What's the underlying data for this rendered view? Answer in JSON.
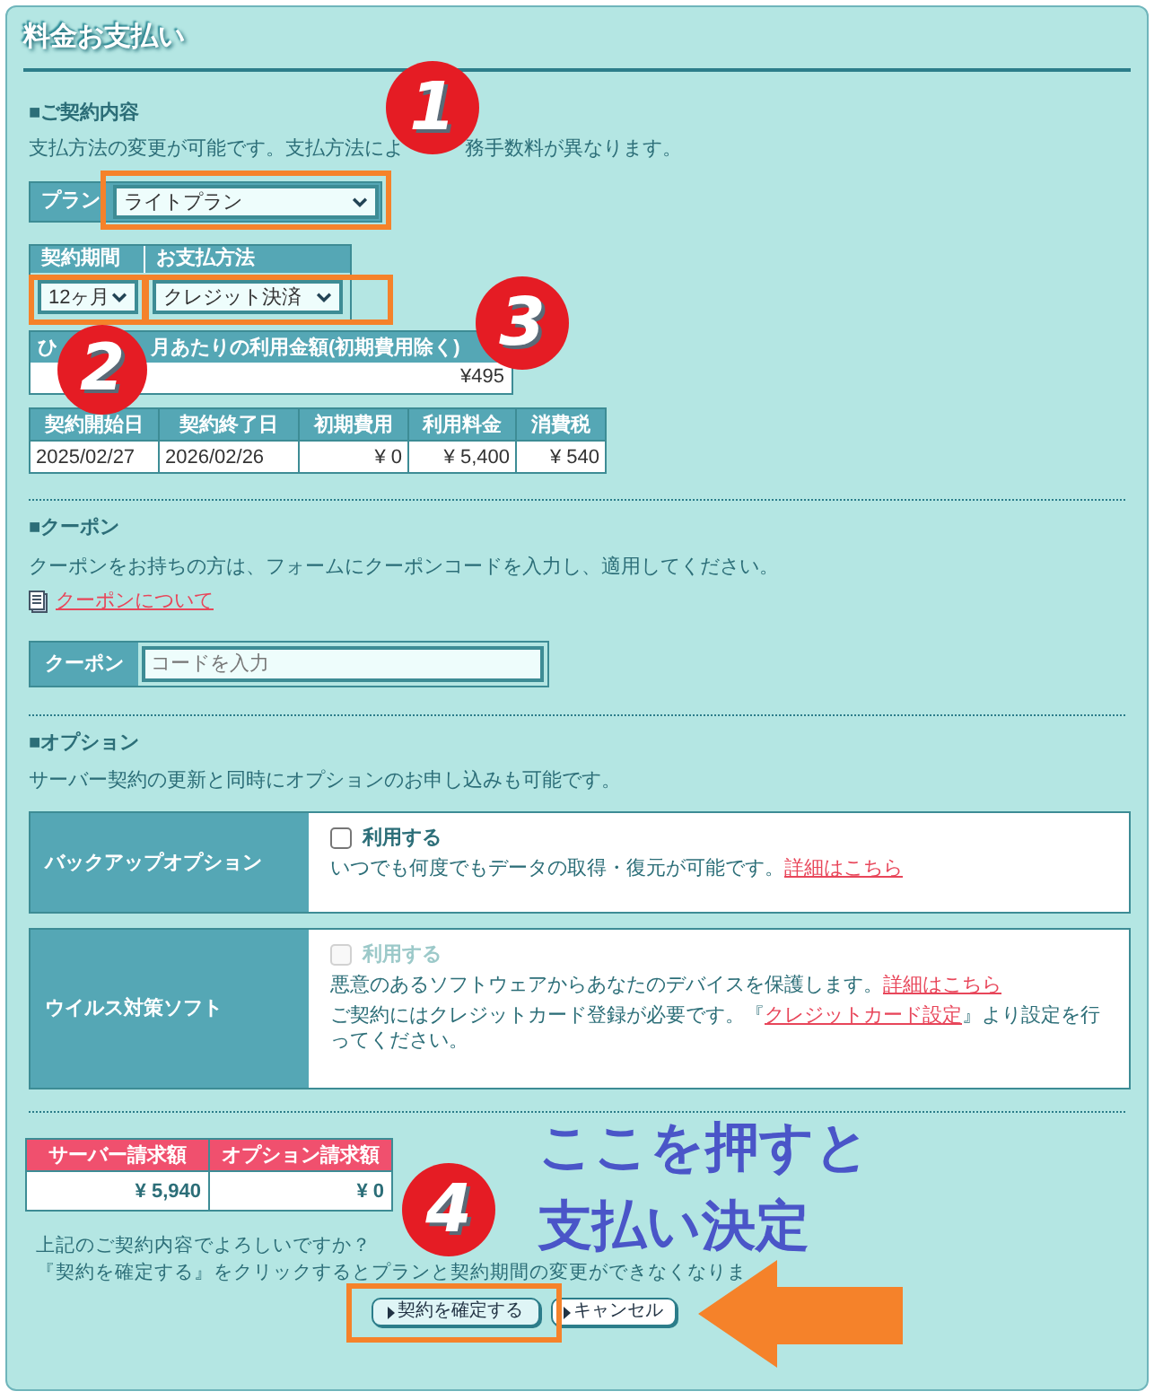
{
  "panel_title": "料金お支払い",
  "contract": {
    "heading": "■ご契約内容",
    "description_parts": [
      "支払方法の変更が可能です。支払方法によ",
      "務手数料が異なります。"
    ],
    "plan": {
      "label": "プラン",
      "value": "ライトプラン"
    },
    "period": {
      "label": "契約期間",
      "value": "12ヶ月"
    },
    "payment": {
      "label": "お支払方法",
      "value": "クレジット決済"
    },
    "monthly": {
      "label_parts": [
        "ひ",
        "月あたりの利用金額(初期費用除く)"
      ],
      "value": "¥495"
    },
    "table": {
      "columns": [
        "契約開始日",
        "契約終了日",
        "初期費用",
        "利用料金",
        "消費税"
      ],
      "rows": [
        [
          "2025/02/27",
          "2026/02/26",
          "¥ 0",
          "¥ 5,400",
          "¥ 540"
        ]
      ]
    }
  },
  "coupon": {
    "heading": "■クーポン",
    "description": "クーポンをお持ちの方は、フォームにクーポンコードを入力し、適用してください。",
    "link": "クーポンについて",
    "label": "クーポン",
    "placeholder": "コードを入力"
  },
  "options": {
    "heading": "■オプション",
    "description": "サーバー契約の更新と同時にオプションのお申し込みも可能です。",
    "items": [
      {
        "name": "バックアップオプション",
        "checkbox_label": "利用する",
        "checked": false,
        "disabled": false,
        "lines": [
          [
            {
              "text": "いつでも何度でもデータの取得・復元が可能です。"
            },
            {
              "text": "詳細はこちら",
              "link": true
            }
          ]
        ]
      },
      {
        "name": "ウイルス対策ソフト",
        "checkbox_label": "利用する",
        "checked": false,
        "disabled": true,
        "lines": [
          [
            {
              "text": "悪意のあるソフトウェアからあなたのデバイスを保護します。"
            },
            {
              "text": "詳細はこちら",
              "link": true
            }
          ],
          [
            {
              "text": "ご契約にはクレジットカード登録が必要です。『"
            },
            {
              "text": "クレジットカード設定",
              "link": true
            },
            {
              "text": "』より設定を行ってください。"
            }
          ]
        ]
      }
    ]
  },
  "totals": {
    "columns": [
      "サーバー請求額",
      "オプション請求額"
    ],
    "values": [
      "¥ 5,940",
      "¥ 0"
    ]
  },
  "confirm_text": [
    "上記のご契約内容でよろしいですか？",
    "『契約を確定する』をクリックするとプランと契約期間の変更ができなくなりま"
  ],
  "buttons": [
    {
      "label": "契約を確定する",
      "kind": "primary"
    },
    {
      "label": "キャンセル",
      "kind": "secondary"
    }
  ],
  "annotations": {
    "markers": [
      "1",
      "2",
      "3",
      "4"
    ],
    "caption": [
      "ここを押すと",
      "支払い決定"
    ]
  }
}
